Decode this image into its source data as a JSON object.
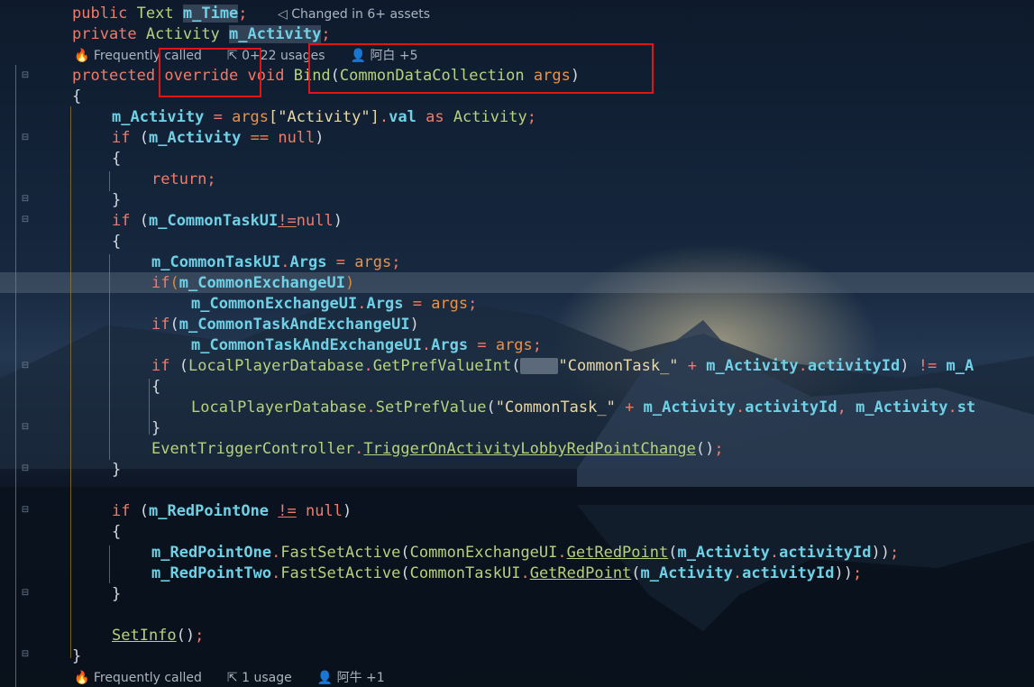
{
  "editor": {
    "code_lines": [
      {
        "k1": "public",
        "t1": "Text",
        "f1": "m_Time",
        "p1": ";"
      },
      {
        "k1": "private",
        "t1": "Activity",
        "f1": "m_Activity",
        "p1": ";"
      },
      {
        "k1": "protected",
        "k2": "override",
        "k3": "void",
        "fn": "Bind",
        "t1": "CommonDataCollection",
        "pa": "args"
      },
      {
        "brace": "{"
      },
      {
        "f1": "m_Activity",
        "op": " = ",
        "pa": "args",
        "s1": "[\"Activity\"]",
        "pr": "val",
        "kw": "as",
        "t1": "Activity"
      },
      {
        "kw": "if",
        "f1": "m_Activity",
        "op": "==",
        "kw2": "null"
      },
      {
        "brace": "{"
      },
      {
        "kw": "return"
      },
      {
        "brace": "}"
      },
      {
        "kw": "if",
        "f1": "m_CommonTaskUI",
        "op": "!=",
        "kw2": "null"
      },
      {
        "brace": "{"
      },
      {
        "f1": "m_CommonTaskUI",
        "pr": "Args",
        "pa": "args"
      },
      {
        "kw": "if",
        "f1": "m_CommonExchangeUI"
      },
      {
        "f1": "m_CommonExchangeUI",
        "pr": "Args",
        "pa": "args"
      },
      {
        "kw": "if",
        "f1": "m_CommonTaskAndExchangeUI"
      },
      {
        "f1": "m_CommonTaskAndExchangeUI",
        "pr": "Args",
        "pa": "args"
      },
      {
        "kw": "if",
        "t1": "LocalPlayerDatabase",
        "fn": "GetPrefValueInt",
        "s1": "\"CommonTask_\"",
        "f1": "m_Activity",
        "pr": "activityId",
        "op": "!=",
        "f2": "m_A"
      },
      {
        "brace": "{"
      },
      {
        "t1": "LocalPlayerDatabase",
        "fn": "SetPrefValue",
        "s1": "\"CommonTask_\"",
        "f1": "m_Activity",
        "pr": "activityId",
        "f2": "m_Activity",
        "pr2": "st"
      },
      {
        "brace": "}"
      },
      {
        "t1": "EventTriggerController",
        "fn": "TriggerOnActivityLobbyRedPointChange"
      },
      {
        "brace": "}"
      },
      {
        "kw": "if",
        "f1": "m_RedPointOne",
        "op": "!=",
        "kw2": "null"
      },
      {
        "brace": "{"
      },
      {
        "f1": "m_RedPointOne",
        "fn": "FastSetActive",
        "t1": "CommonExchangeUI",
        "fn2": "GetRedPoint",
        "f2": "m_Activity",
        "pr": "activityId"
      },
      {
        "f1": "m_RedPointTwo",
        "fn": "FastSetActive",
        "t1": "CommonTaskUI",
        "fn2": "GetRedPoint",
        "f2": "m_Activity",
        "pr": "activityId"
      },
      {
        "brace": "}"
      },
      {
        "fn": "SetInfo"
      },
      {
        "brace": "}"
      }
    ],
    "hints": {
      "top_changed": "Changed in 6+ assets",
      "bind_freq": "Frequently called",
      "bind_usages": "0+22 usages",
      "bind_authors": "阿白 +5",
      "bottom_freq": "Frequently called",
      "bottom_usages": "1 usage",
      "bottom_authors": "阿牛 +1"
    }
  }
}
